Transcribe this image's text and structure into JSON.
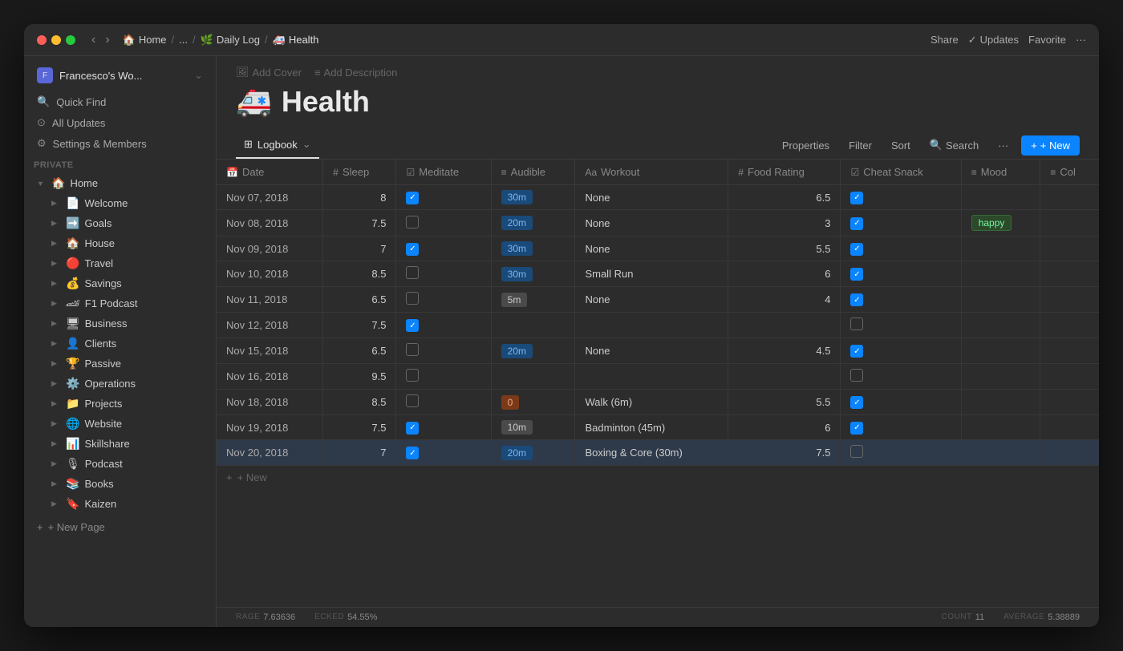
{
  "window": {
    "title": "Francesco's Wo..."
  },
  "titlebar": {
    "back": "‹",
    "forward": "›",
    "breadcrumbs": [
      {
        "label": "Home",
        "icon": "🏠"
      },
      {
        "label": "..."
      },
      {
        "label": "Daily Log",
        "icon": "🌿"
      },
      {
        "label": "Health",
        "icon": "🚑"
      }
    ],
    "actions": {
      "share": "Share",
      "updates": "Updates",
      "favorite": "Favorite",
      "more": "···"
    }
  },
  "sidebar": {
    "workspace": "Francesco's Wo...",
    "actions": [
      {
        "icon": "🔍",
        "label": "Quick Find"
      },
      {
        "icon": "⊙",
        "label": "All Updates"
      },
      {
        "icon": "⚙",
        "label": "Settings & Members"
      }
    ],
    "section_label": "PRIVATE",
    "items": [
      {
        "icon": "🏠",
        "label": "Home",
        "expanded": true,
        "level": 0
      },
      {
        "icon": "📄",
        "label": "Welcome",
        "level": 1
      },
      {
        "icon": "➡️",
        "label": "Goals",
        "level": 1
      },
      {
        "icon": "🏠",
        "label": "House",
        "level": 1
      },
      {
        "icon": "🔴",
        "label": "Travel",
        "level": 1
      },
      {
        "icon": "💰",
        "label": "Savings",
        "level": 1
      },
      {
        "icon": "🏎",
        "label": "F1 Podcast",
        "level": 1
      },
      {
        "icon": "🖥",
        "label": "Business",
        "level": 1
      },
      {
        "icon": "👤",
        "label": "Clients",
        "level": 1
      },
      {
        "icon": "🏆",
        "label": "Passive",
        "level": 1
      },
      {
        "icon": "⚙️",
        "label": "Operations",
        "level": 1
      },
      {
        "icon": "📁",
        "label": "Projects",
        "level": 1
      },
      {
        "icon": "🌐",
        "label": "Website",
        "level": 1
      },
      {
        "icon": "📊",
        "label": "Skillshare",
        "level": 1
      },
      {
        "icon": "🎙",
        "label": "Podcast",
        "level": 1
      },
      {
        "icon": "📚",
        "label": "Books",
        "level": 1
      },
      {
        "icon": "🔖",
        "label": "Kaizen",
        "level": 1
      }
    ],
    "new_page": "+ New Page"
  },
  "page": {
    "add_cover": "Add Cover",
    "add_description": "Add Description",
    "emoji": "🚑",
    "title": "Health"
  },
  "view": {
    "tabs": [
      {
        "icon": "⊞",
        "label": "Logbook",
        "active": true
      }
    ],
    "actions": {
      "properties": "Properties",
      "filter": "Filter",
      "sort": "Sort",
      "search": "Search",
      "more": "···",
      "new": "+ New"
    }
  },
  "table": {
    "columns": [
      {
        "icon": "📅",
        "label": "Date"
      },
      {
        "icon": "#",
        "label": "Sleep"
      },
      {
        "icon": "☑",
        "label": "Meditate"
      },
      {
        "icon": "≡",
        "label": "Audible"
      },
      {
        "icon": "Aa",
        "label": "Workout"
      },
      {
        "icon": "#",
        "label": "Food Rating"
      },
      {
        "icon": "☑",
        "label": "Cheat Snack"
      },
      {
        "icon": "≡",
        "label": "Mood"
      },
      {
        "icon": "≡",
        "label": "Col"
      }
    ],
    "rows": [
      {
        "date": "Nov 07, 2018",
        "sleep": "8",
        "meditate": true,
        "audible": "30m",
        "audible_color": "blue",
        "workout": "None",
        "food_rating": "6.5",
        "cheat_snack": true,
        "mood": "",
        "active": false
      },
      {
        "date": "Nov 08, 2018",
        "sleep": "7.5",
        "meditate": false,
        "audible": "20m",
        "audible_color": "blue",
        "workout": "None",
        "food_rating": "3",
        "cheat_snack": true,
        "mood": "happy",
        "active": false
      },
      {
        "date": "Nov 09, 2018",
        "sleep": "7",
        "meditate": true,
        "audible": "30m",
        "audible_color": "blue",
        "workout": "None",
        "food_rating": "5.5",
        "cheat_snack": true,
        "mood": "",
        "active": false
      },
      {
        "date": "Nov 10, 2018",
        "sleep": "8.5",
        "meditate": false,
        "audible": "30m",
        "audible_color": "blue",
        "workout": "Small Run",
        "food_rating": "6",
        "cheat_snack": true,
        "mood": "",
        "active": false
      },
      {
        "date": "Nov 11, 2018",
        "sleep": "6.5",
        "meditate": false,
        "audible": "5m",
        "audible_color": "gray",
        "workout": "None",
        "food_rating": "4",
        "cheat_snack": true,
        "mood": "",
        "active": false
      },
      {
        "date": "Nov 12, 2018",
        "sleep": "7.5",
        "meditate": true,
        "audible": "",
        "audible_color": "",
        "workout": "",
        "food_rating": "",
        "cheat_snack": false,
        "mood": "",
        "active": false
      },
      {
        "date": "Nov 15, 2018",
        "sleep": "6.5",
        "meditate": false,
        "audible": "20m",
        "audible_color": "blue",
        "workout": "None",
        "food_rating": "4.5",
        "cheat_snack": true,
        "mood": "",
        "active": false
      },
      {
        "date": "Nov 16, 2018",
        "sleep": "9.5",
        "meditate": false,
        "audible": "",
        "audible_color": "",
        "workout": "",
        "food_rating": "",
        "cheat_snack": false,
        "mood": "",
        "active": false
      },
      {
        "date": "Nov 18, 2018",
        "sleep": "8.5",
        "meditate": false,
        "audible": "0",
        "audible_color": "orange",
        "workout": "Walk (6m)",
        "food_rating": "5.5",
        "cheat_snack": true,
        "mood": "",
        "active": false
      },
      {
        "date": "Nov 19, 2018",
        "sleep": "7.5",
        "meditate": true,
        "audible": "10m",
        "audible_color": "gray",
        "workout": "Badminton (45m)",
        "food_rating": "6",
        "cheat_snack": true,
        "mood": "",
        "active": false
      },
      {
        "date": "Nov 20, 2018",
        "sleep": "7",
        "meditate": true,
        "audible": "20m",
        "audible_color": "blue",
        "workout": "Boxing & Core (30m)",
        "food_rating": "7.5",
        "cheat_snack": false,
        "mood": "",
        "active": true
      }
    ],
    "add_new": "+ New"
  },
  "footer": {
    "stats": [
      {
        "label": "RAGE",
        "value": "7.63636"
      },
      {
        "label": "ECKED",
        "value": "54.55%"
      },
      {
        "label": "COUNT",
        "value": "11"
      },
      {
        "label": "AVERAGE",
        "value": "5.38889"
      }
    ]
  }
}
